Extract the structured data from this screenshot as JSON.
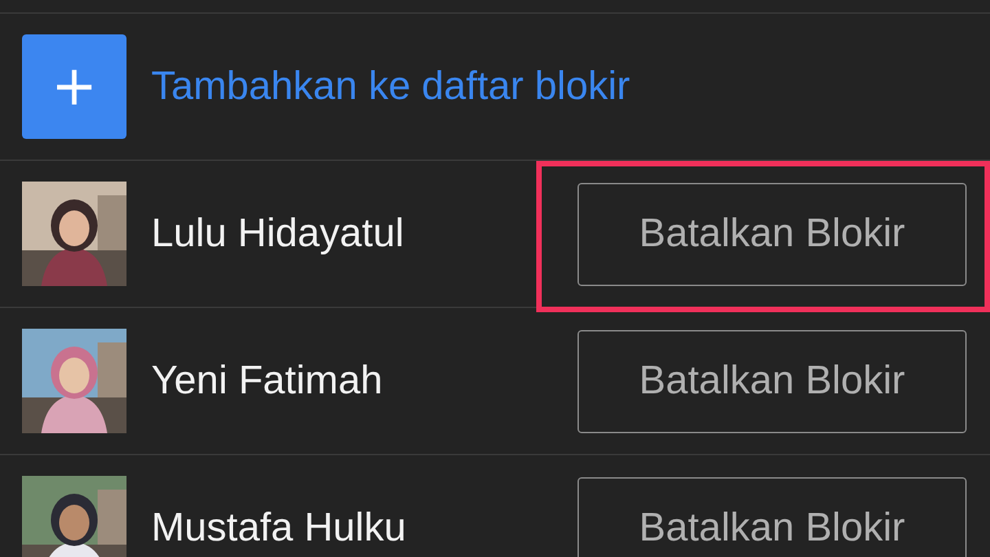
{
  "add_action": {
    "icon": "+",
    "label": "Tambahkan ke daftar blokir"
  },
  "blocked_users": [
    {
      "name": "Lulu Hidayatul",
      "button": "Batalkan Blokir",
      "highlighted": true
    },
    {
      "name": "Yeni Fatimah",
      "button": "Batalkan Blokir",
      "highlighted": false
    },
    {
      "name": "Mustafa Hulku",
      "button": "Batalkan Blokir",
      "highlighted": false
    }
  ]
}
